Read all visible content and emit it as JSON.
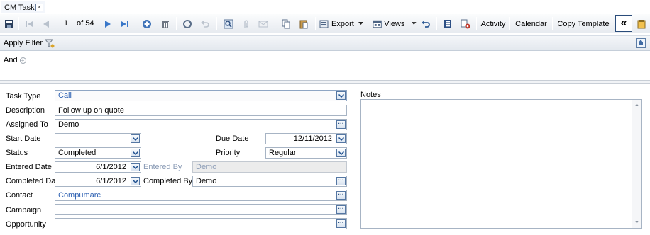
{
  "tab": {
    "title": "CM Tasks",
    "close_glyph": "×"
  },
  "toolbar": {
    "pager_current": "1",
    "pager_of": "of 54",
    "export_label": "Export",
    "views_label": "Views",
    "activity_label": "Activity",
    "calendar_label": "Calendar",
    "copy_template_label": "Copy Template",
    "collapse_glyph": "«"
  },
  "filter": {
    "apply_label": "Apply Filter",
    "and_label": "And",
    "plus_glyph": "+"
  },
  "form": {
    "task_type": {
      "label": "Task Type",
      "value": "Call"
    },
    "description": {
      "label": "Description",
      "value": "Follow up on quote"
    },
    "assigned_to": {
      "label": "Assigned To",
      "value": "Demo"
    },
    "start_date": {
      "label": "Start Date",
      "value": ""
    },
    "due_date": {
      "label": "Due Date",
      "value": "12/11/2012"
    },
    "status": {
      "label": "Status",
      "value": "Completed"
    },
    "priority": {
      "label": "Priority",
      "value": "Regular"
    },
    "entered_date": {
      "label": "Entered Date",
      "value": "6/1/2012"
    },
    "entered_by": {
      "label": "Entered By",
      "value": "Demo"
    },
    "completed_date": {
      "label": "Completed Date",
      "value": "6/1/2012"
    },
    "completed_by": {
      "label": "Completed By",
      "value": "Demo"
    },
    "contact": {
      "label": "Contact",
      "value": "Compumarc"
    },
    "campaign": {
      "label": "Campaign",
      "value": ""
    },
    "opportunity": {
      "label": "Opportunity",
      "value": ""
    },
    "ellipsis": "···"
  },
  "notes": {
    "label": "Notes",
    "up_glyph": "▲",
    "down_glyph": "▼"
  },
  "colors": {
    "accent": "#2f62b3",
    "nav_blue": "#3a78c9",
    "border": "#a7b4c4",
    "disabled_text": "#8a9bb5"
  },
  "icons": [
    "save-icon",
    "first-record-icon",
    "prev-record-icon",
    "next-record-icon",
    "last-record-icon",
    "add-icon",
    "delete-icon",
    "refresh-icon",
    "undo-disabled-icon",
    "find-icon",
    "attach-icon",
    "email-icon",
    "copy-icon",
    "paste-icon",
    "export-icon",
    "views-icon",
    "undo-icon",
    "list-icon",
    "settings-icon",
    "collapse-icon",
    "note-icon",
    "filter-icon"
  ]
}
